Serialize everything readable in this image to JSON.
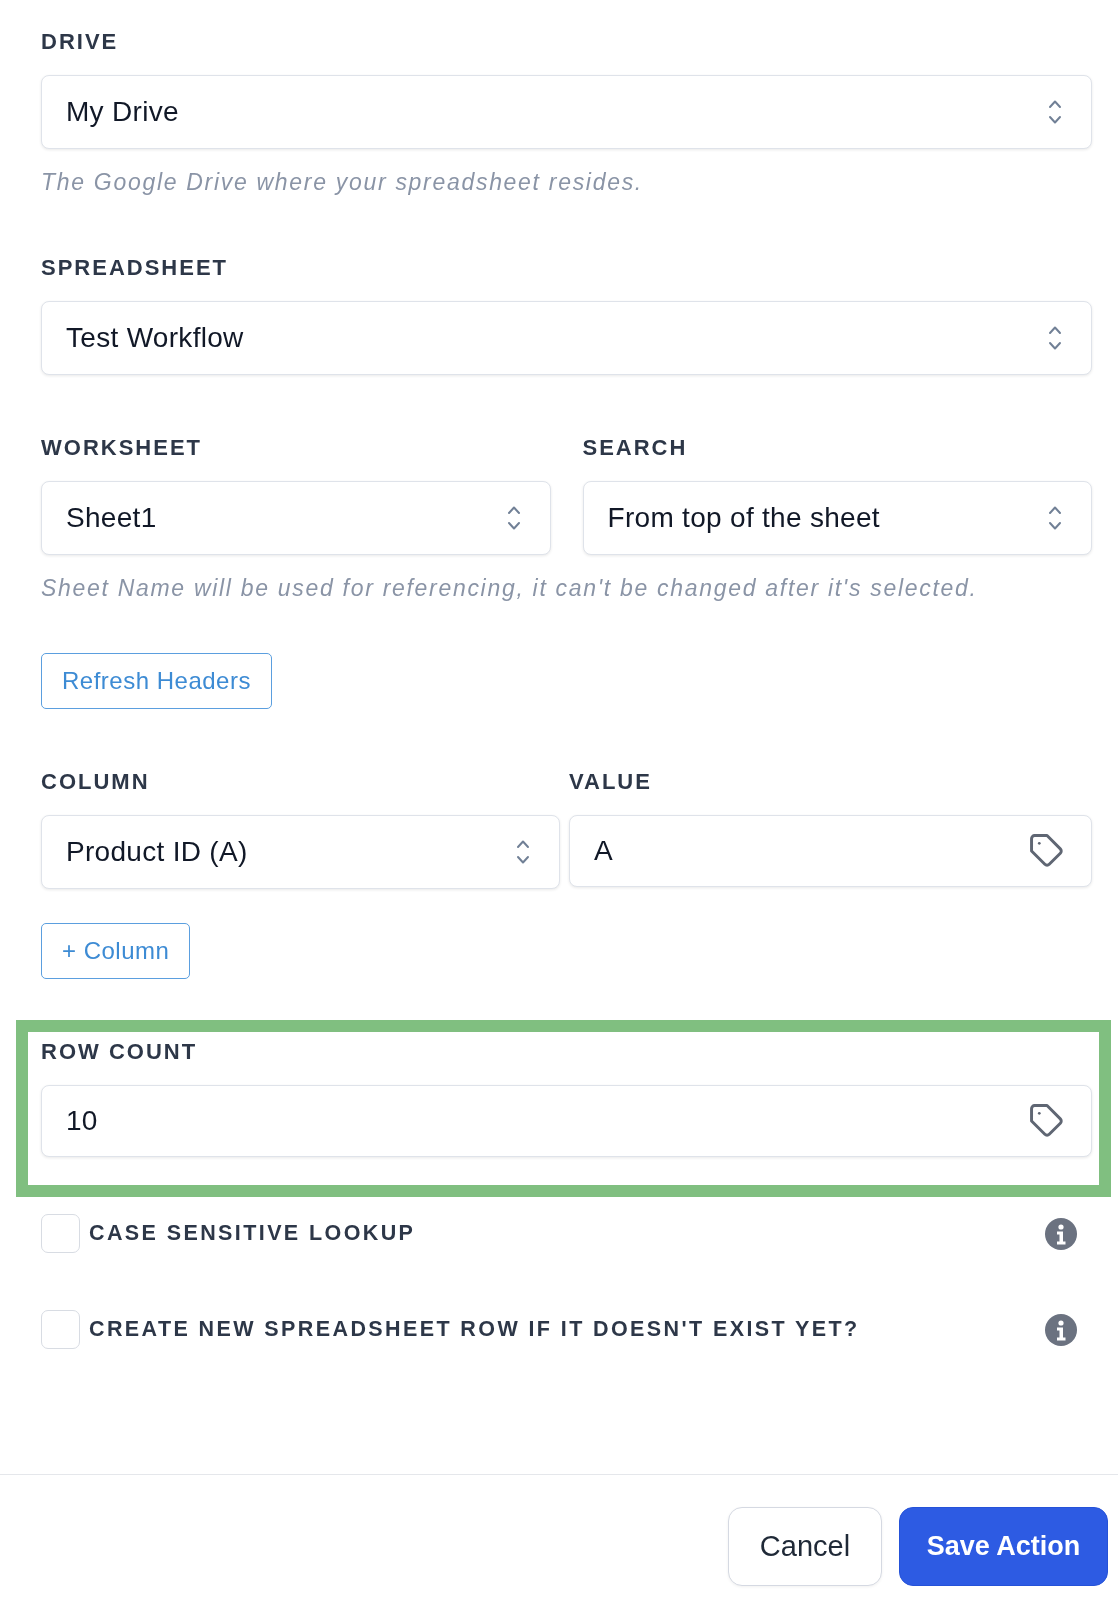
{
  "sections": [
    {
      "kind": "select",
      "label": "DRIVE",
      "value": "My Drive",
      "hint": "The Google Drive where your spreadsheet resides."
    },
    {
      "kind": "select",
      "label": "SPREADSHEET",
      "value": "Test Workflow"
    },
    {
      "kind": "pair",
      "fields": [
        {
          "kind": "select",
          "label": "WORKSHEET",
          "value": "Sheet1"
        },
        {
          "kind": "select",
          "label": "SEARCH",
          "value": "From top of the sheet"
        }
      ],
      "hint": "Sheet Name will be used for referencing, it can't be changed after it's selected."
    },
    {
      "kind": "button",
      "label": "Refresh Headers"
    },
    {
      "kind": "pair",
      "fields": [
        {
          "kind": "select",
          "label": "COLUMN",
          "value": "Product ID (A)"
        },
        {
          "kind": "tag_input",
          "label": "VALUE",
          "value": "A"
        }
      ]
    },
    {
      "kind": "button",
      "label": "+ Column"
    },
    {
      "kind": "tag_input",
      "label": "ROW COUNT",
      "value": "10",
      "highlighted": true
    },
    {
      "kind": "checkbox",
      "label": "CASE SENSITIVE LOOKUP",
      "checked": false
    },
    {
      "kind": "checkbox",
      "label": "CREATE NEW SPREADSHEET ROW IF IT DOESN'T EXIST YET?",
      "checked": false
    }
  ],
  "footer": {
    "buttons": [
      {
        "kind": "secondary",
        "label": "Cancel"
      },
      {
        "kind": "primary",
        "label": "Save Action"
      }
    ]
  }
}
